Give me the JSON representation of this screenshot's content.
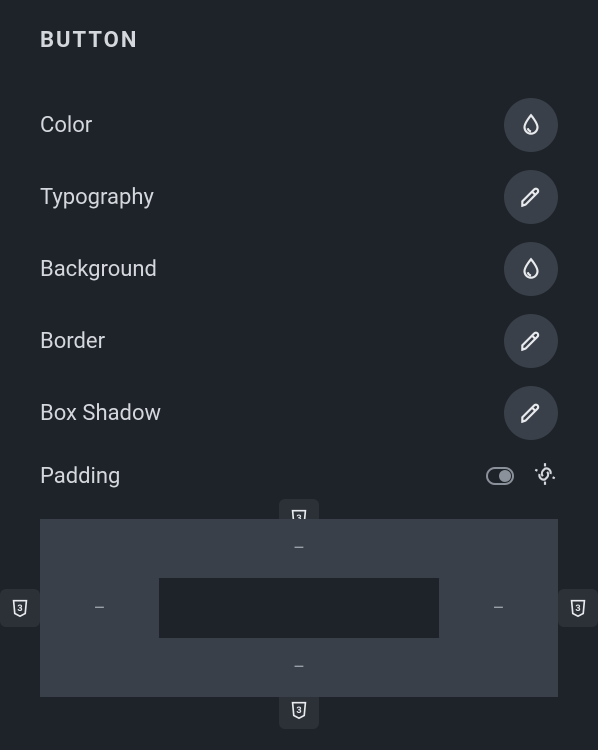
{
  "section_title": "BUTTON",
  "rows": {
    "color": {
      "label": "Color",
      "icon": "drop"
    },
    "typography": {
      "label": "Typography",
      "icon": "pencil"
    },
    "background": {
      "label": "Background",
      "icon": "drop"
    },
    "border": {
      "label": "Border",
      "icon": "pencil"
    },
    "box_shadow": {
      "label": "Box Shadow",
      "icon": "pencil"
    }
  },
  "padding": {
    "label": "Padding",
    "top": "–",
    "right": "–",
    "bottom": "–",
    "left": "–",
    "toggle_on": true,
    "linked": false,
    "css_tag": "3"
  }
}
